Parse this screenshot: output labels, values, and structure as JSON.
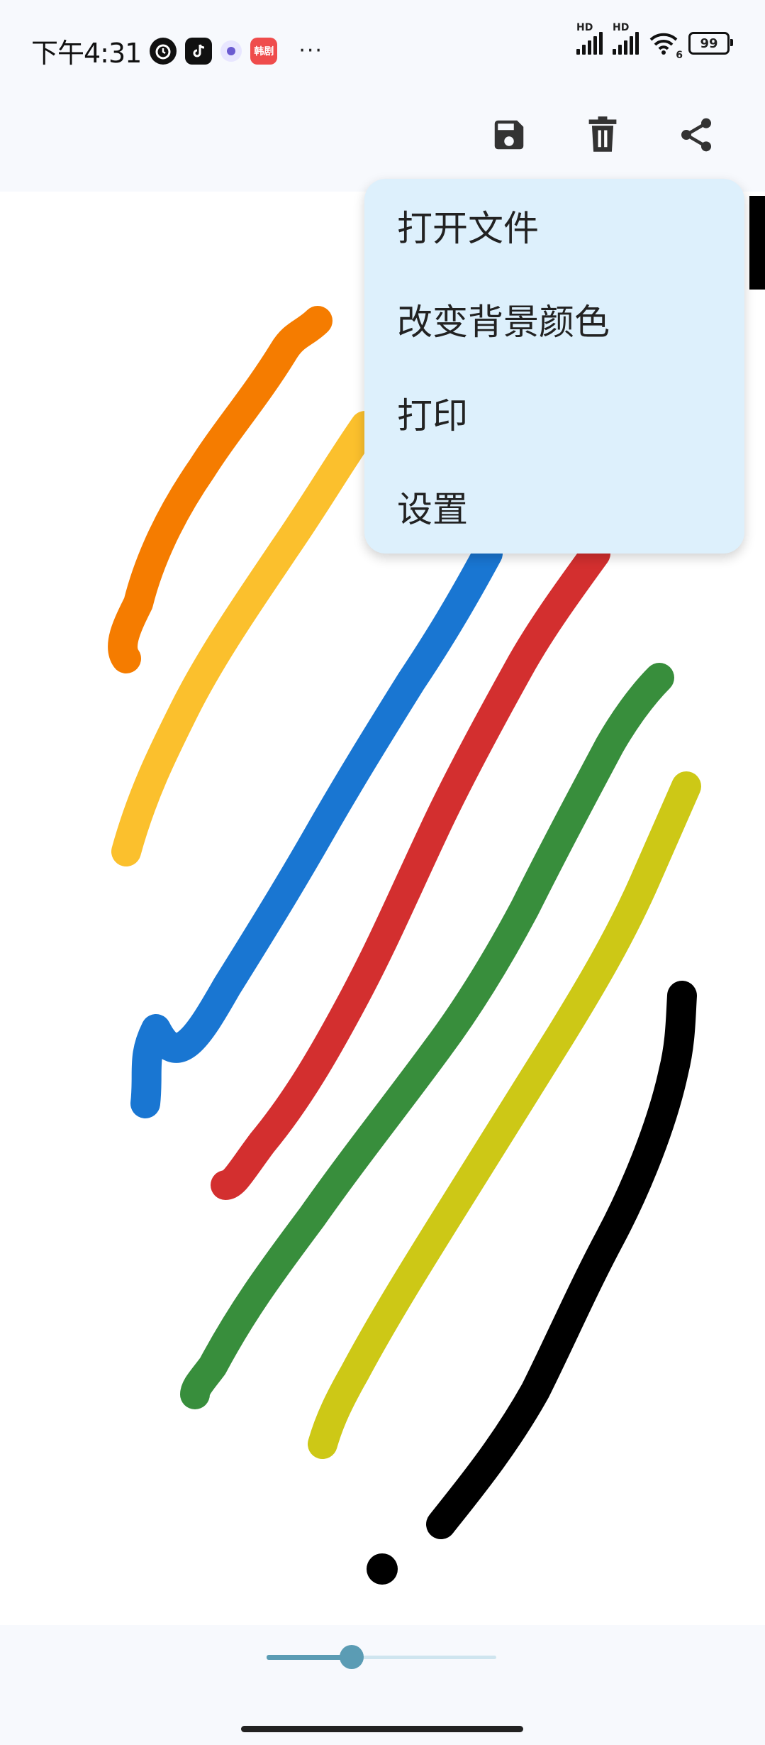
{
  "status_bar": {
    "time": "下午4:31",
    "app_icons": [
      "alarm-clock-icon",
      "tiktok-icon",
      "app-icon",
      "app-icon"
    ],
    "red_app_label": "韩剧",
    "more": "···",
    "signal_label_1": "HD",
    "signal_label_2": "HD",
    "wifi_label": "6",
    "battery": "99"
  },
  "toolbar": {
    "icons": [
      "save-icon",
      "delete-icon",
      "share-icon",
      "more-vert-icon"
    ]
  },
  "menu": {
    "items": [
      {
        "label": "打开文件"
      },
      {
        "label": "改变背景颜色"
      },
      {
        "label": "打印"
      },
      {
        "label": "设置"
      }
    ],
    "background": "#ddf0fc"
  },
  "canvas": {
    "stroke_colors": {
      "orange": "#f57c00",
      "yellow": "#fbc02d",
      "blue": "#1976d2",
      "red": "#d32f2f",
      "green": "#388e3c",
      "olive": "#cdc816",
      "black": "#000000"
    }
  },
  "brush_size_slider": {
    "value_fraction": 0.37,
    "color": "#5b9cb4"
  }
}
